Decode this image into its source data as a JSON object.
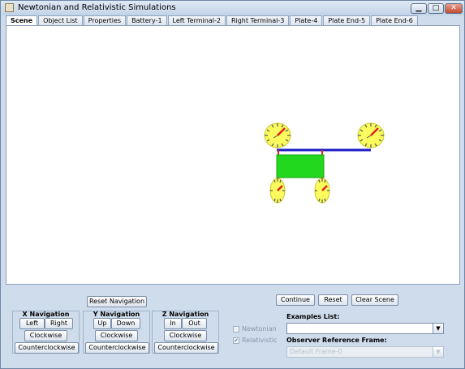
{
  "window": {
    "title": "Newtonian and Relativistic Simulations",
    "minimize": "▁",
    "maximize": "□",
    "close": "✕"
  },
  "tabs": [
    "Scene",
    "Object List",
    "Properties",
    "Battery-1",
    "Left Terminal-2",
    "Right Terminal-3",
    "Plate-4",
    "Plate End-5",
    "Plate End-6"
  ],
  "active_tab": "Scene",
  "scene": {
    "colors": {
      "clock_face": "#fbfb5e",
      "clock_hand": "#e0201c",
      "rod": "#1c1cc8",
      "battery": "#22d81f",
      "terminal": "#e0201c"
    },
    "icons": [
      "clock-icon"
    ]
  },
  "controls": {
    "reset_navigation": "Reset Navigation",
    "x_nav": {
      "title": "X Navigation",
      "left": "Left",
      "right": "Right",
      "clockwise": "Clockwise",
      "counterclockwise": "Counterclockwise"
    },
    "y_nav": {
      "title": "Y Navigation",
      "up": "Up",
      "down": "Down",
      "clockwise": "Clockwise",
      "counterclockwise": "Counterclockwise"
    },
    "z_nav": {
      "title": "Z Navigation",
      "in": "In",
      "out": "Out",
      "clockwise": "Clockwise",
      "counterclockwise": "Counterclockwise"
    },
    "newtonian": {
      "label": "Newtonian",
      "checked": false
    },
    "relativistic": {
      "label": "Relativistic",
      "checked": true
    },
    "continue": "Continue",
    "reset": "Reset",
    "clear_scene": "Clear Scene",
    "examples_list_label": "Examples List:",
    "examples_list_value": "",
    "observer_frame_label": "Observer Reference Frame:",
    "observer_frame_value": "Default Frame-0"
  }
}
